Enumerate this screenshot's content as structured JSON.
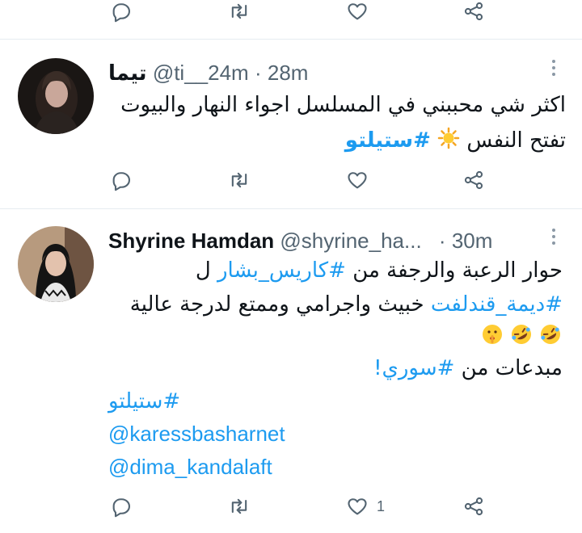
{
  "colors": {
    "accent": "#1d9bf0",
    "text": "#0f1419",
    "muted": "#536471",
    "divider": "#e6ecf0"
  },
  "tweet1": {
    "name": "تيما",
    "handle": "@ti__24m",
    "separator": "·",
    "time": "28m",
    "line1": "اكثر شي محببني في المسلسل اجواء النهار والبيوت",
    "line2_text": "تفتح النفس",
    "line2_emoji": "sun-emoji",
    "line2_tag": "#ستيلتو"
  },
  "tweet2": {
    "name": "Shyrine Hamdan",
    "handle": "@shyrine_ha...",
    "separator": "·",
    "time": "30m",
    "line1_text": "حوار الرعبة والرجفة من",
    "line1_tag": "#كاريس_بشار",
    "line1_end": "ل",
    "line2_tag": "#ديمة_قندلفت",
    "line2_text": "خبيث واجرامي وممتع لدرجة عالية",
    "line3_emojis": [
      "rolling-laughing-emoji",
      "rolling-laughing-emoji",
      "shushing-face-emoji"
    ],
    "line4_text": "مبدعات من",
    "line4_tag": "#سوري!",
    "line5_tag": "#ستيلتو",
    "line6_mention": "@karessbasharnet",
    "line7_mention": "@dima_kandalaft",
    "like_count": "1"
  }
}
